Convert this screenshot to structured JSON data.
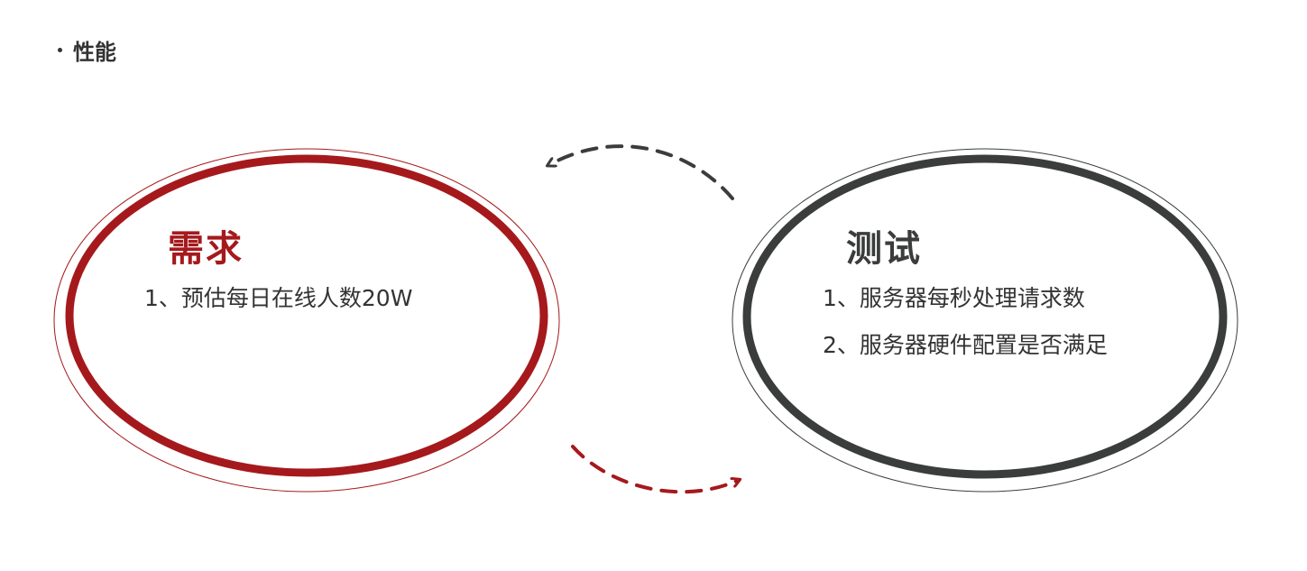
{
  "heading": {
    "title": "性能"
  },
  "colors": {
    "requirement": "#a5191c",
    "test": "#3b3d3d",
    "text": "#333333"
  },
  "nodes": {
    "requirement": {
      "title": "需求",
      "items": [
        "1、预估每日在线人数20W"
      ]
    },
    "test": {
      "title": "测试",
      "items": [
        "1、服务器每秒处理请求数",
        "2、服务器硬件配置是否满足"
      ]
    }
  },
  "edges": [
    {
      "from": "requirement",
      "to": "test",
      "style": "dashed",
      "color": "#a5191c"
    },
    {
      "from": "test",
      "to": "requirement",
      "style": "dashed",
      "color": "#3b3d3d"
    }
  ]
}
